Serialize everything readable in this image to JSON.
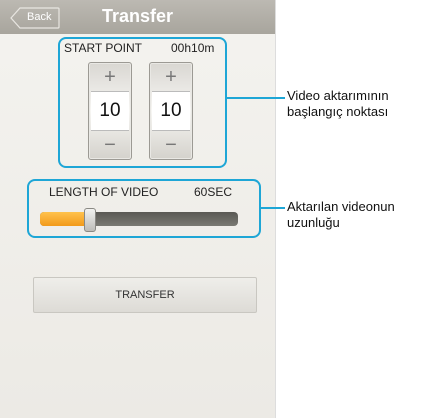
{
  "header": {
    "back_label": "Back",
    "title": "Transfer"
  },
  "start_point": {
    "label": "START POINT",
    "value": "00h10m",
    "spinners": [
      {
        "up_symbol": "+",
        "value": "10",
        "down_symbol": "−"
      },
      {
        "up_symbol": "+",
        "value": "10",
        "down_symbol": "−"
      }
    ]
  },
  "video_length": {
    "label": "LENGTH OF VIDEO",
    "value": "60SEC",
    "slider_level": 0.25
  },
  "transfer_button": {
    "label": "TRANSFER"
  },
  "callouts": {
    "start_point_line1": "Video aktarımının",
    "start_point_line2": "başlangıç noktası",
    "length_line1": "Aktarılan videonun",
    "length_line2": "uzunluğu"
  },
  "colors": {
    "highlight": "#1ea6d6",
    "slider_fill": "#f29a1b"
  }
}
